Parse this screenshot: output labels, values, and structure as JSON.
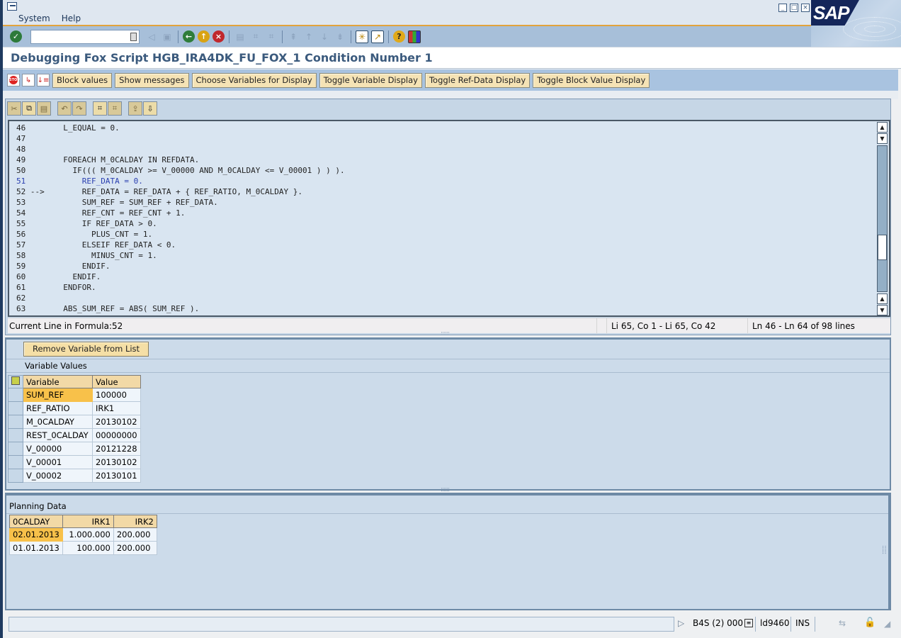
{
  "window": {
    "menu": [
      "System",
      "Help"
    ],
    "controls": [
      "minimize",
      "maximize",
      "close"
    ],
    "brand": "SAP"
  },
  "std_toolbar": {
    "command_field": {
      "value": "",
      "placeholder": ""
    },
    "icons": [
      "enter-icon",
      "back-arrow-icon",
      "save-icon",
      "back-icon",
      "exit-icon",
      "cancel-icon",
      "print-icon",
      "find-icon",
      "find-next-icon",
      "first-page-icon",
      "previous-page-icon",
      "next-page-icon",
      "last-page-icon",
      "create-session-icon",
      "shortcut-icon",
      "help-icon",
      "customize-layout-icon"
    ]
  },
  "page": {
    "title": "Debugging Fox Script HGB_IRA4DK_FU_FOX_1 Condition Number 1"
  },
  "app_toolbar": {
    "icons": [
      "stop-icon",
      "step-into-icon",
      "breakpoint-list-icon"
    ],
    "buttons": [
      "Block values",
      "Show messages",
      "Choose Variables for Display",
      "Toggle Variable Display",
      "Toggle Ref-Data Display",
      "Toggle Block Value Display"
    ]
  },
  "editor": {
    "toolbar_icons": [
      "cut-icon",
      "copy-icon",
      "paste-icon",
      "undo-icon",
      "redo-icon",
      "find-icon",
      "find-next-icon",
      "upload-icon",
      "download-icon"
    ],
    "current_line": 52,
    "highlighted_line": 51,
    "lines": [
      {
        "no": "46",
        "marker": "   ",
        "text": "    L_EQUAL = 0."
      },
      {
        "no": "47",
        "marker": "   ",
        "text": ""
      },
      {
        "no": "48",
        "marker": "   ",
        "text": ""
      },
      {
        "no": "49",
        "marker": "   ",
        "text": "    FOREACH M_0CALDAY IN REFDATA."
      },
      {
        "no": "50",
        "marker": "   ",
        "text": "      IF((( M_0CALDAY >= V_00000 AND M_0CALDAY <= V_00001 ) ) )."
      },
      {
        "no": "51",
        "marker": "   ",
        "text": "        REF_DATA = 0."
      },
      {
        "no": "52",
        "marker": "-->",
        "text": "        REF_DATA = REF_DATA + { REF_RATIO, M_0CALDAY }."
      },
      {
        "no": "53",
        "marker": "   ",
        "text": "        SUM_REF = SUM_REF + REF_DATA."
      },
      {
        "no": "54",
        "marker": "   ",
        "text": "        REF_CNT = REF_CNT + 1."
      },
      {
        "no": "55",
        "marker": "   ",
        "text": "        IF REF_DATA > 0."
      },
      {
        "no": "56",
        "marker": "   ",
        "text": "          PLUS_CNT = 1."
      },
      {
        "no": "57",
        "marker": "   ",
        "text": "        ELSEIF REF_DATA < 0."
      },
      {
        "no": "58",
        "marker": "   ",
        "text": "          MINUS_CNT = 1."
      },
      {
        "no": "59",
        "marker": "   ",
        "text": "        ENDIF."
      },
      {
        "no": "60",
        "marker": "   ",
        "text": "      ENDIF."
      },
      {
        "no": "61",
        "marker": "   ",
        "text": "    ENDFOR."
      },
      {
        "no": "62",
        "marker": "   ",
        "text": ""
      },
      {
        "no": "63",
        "marker": "   ",
        "text": "    ABS_SUM_REF = ABS( SUM_REF )."
      }
    ],
    "scroll_position": 0.74,
    "status": {
      "current_line": "Current Line in Formula:52",
      "selection": "Li 65, Co 1 - Li 65, Co 42",
      "range": "Ln 46 - Ln 64 of 98 lines"
    }
  },
  "variables": {
    "remove_button": "Remove Variable from List",
    "section_label": "Variable Values",
    "columns": [
      "Variable",
      "Value"
    ],
    "rows": [
      {
        "name": "SUM_REF",
        "value": "100000",
        "selected": true
      },
      {
        "name": "REF_RATIO",
        "value": "IRK1"
      },
      {
        "name": "M_0CALDAY",
        "value": "20130102"
      },
      {
        "name": "REST_0CALDAY",
        "value": "00000000"
      },
      {
        "name": "V_00000",
        "value": "20121228"
      },
      {
        "name": "V_00001",
        "value": "20130102"
      },
      {
        "name": "V_00002",
        "value": "20130101"
      }
    ]
  },
  "planning": {
    "section_label": "Planning Data",
    "columns": [
      "0CALDAY",
      "IRK1",
      "IRK2"
    ],
    "rows": [
      {
        "calday": "02.01.2013",
        "irk1": "1.000.000",
        "irk2": "200.000",
        "selected": true
      },
      {
        "calday": "01.01.2013",
        "irk1": "100.000",
        "irk2": "200.000"
      }
    ]
  },
  "statusbar": {
    "system": "B4S (2) 000",
    "server": "ld9460",
    "mode": "INS"
  }
}
